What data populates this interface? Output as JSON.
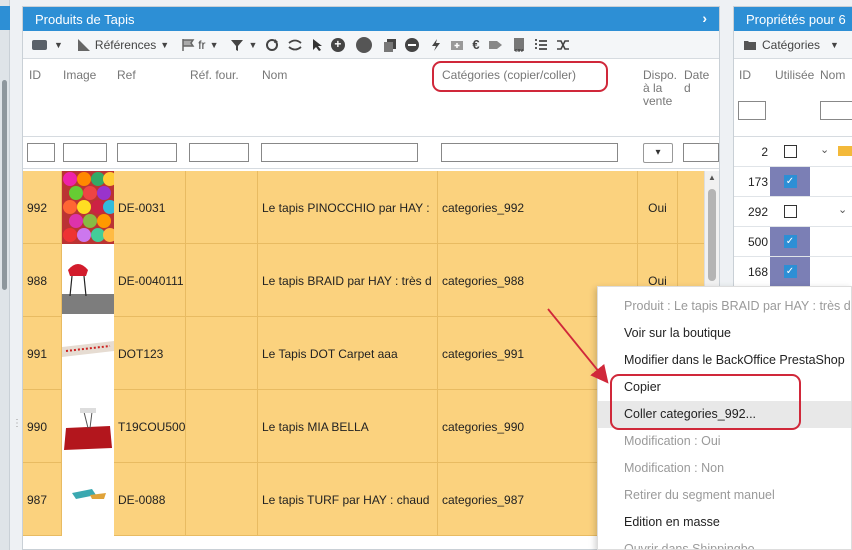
{
  "panel": {
    "title": "Produits de Tapis"
  },
  "right_panel": {
    "title": "Propriétés pour 6",
    "toolbar_label": "Catégories"
  },
  "toolbar": {
    "references_label": "Références",
    "lang_label": "fr"
  },
  "columns": {
    "id": "ID",
    "image": "Image",
    "ref": "Ref",
    "ref_four": "Réf. four.",
    "nom": "Nom",
    "categories": "Catégories (copier/coller)",
    "dispo_1": "Dispo.",
    "dispo_2": "à la",
    "dispo_3": "vente",
    "date": "Date d"
  },
  "rows": [
    {
      "id": "992",
      "ref": "DE-0031",
      "nom": "Le tapis PINOCCHIO par HAY :",
      "categories": "categories_992",
      "dispo": "Oui"
    },
    {
      "id": "988",
      "ref": "DE-0040111",
      "nom": "Le tapis BRAID par HAY : très d",
      "categories": "categories_988",
      "dispo": "Oui"
    },
    {
      "id": "991",
      "ref": "DOT123",
      "nom": "Le Tapis DOT Carpet aaa",
      "categories": "categories_991",
      "dispo": ""
    },
    {
      "id": "990",
      "ref": "T19COU500",
      "nom": "Le tapis MIA BELLA",
      "categories": "categories_990",
      "dispo": ""
    },
    {
      "id": "987",
      "ref": "DE-0088",
      "nom": "Le tapis TURF par HAY : chaud",
      "categories": "categories_987",
      "dispo": ""
    }
  ],
  "right_columns": {
    "id": "ID",
    "utilisee": "Utilisée",
    "nom": "Nom"
  },
  "right_rows": [
    {
      "id": "2",
      "checked": false
    },
    {
      "id": "173",
      "checked": true
    },
    {
      "id": "292",
      "checked": false
    },
    {
      "id": "500",
      "checked": true
    },
    {
      "id": "168",
      "checked": true
    }
  ],
  "context_menu": {
    "items": [
      {
        "label": "Produit : Le tapis BRAID par HAY : très d",
        "disabled": true
      },
      {
        "label": "Voir sur la boutique",
        "disabled": false
      },
      {
        "label": "Modifier dans le BackOffice PrestaShop",
        "disabled": false
      },
      {
        "label": "Copier",
        "disabled": false
      },
      {
        "label": "Coller categories_992...",
        "disabled": false
      },
      {
        "label": "Modification : Oui",
        "disabled": true
      },
      {
        "label": "Modification : Non",
        "disabled": true
      },
      {
        "label": "Retirer du segment manuel",
        "disabled": true
      },
      {
        "label": "Edition en masse",
        "disabled": false
      },
      {
        "label": "Ouvrir dans Shippingbo",
        "disabled": true
      }
    ]
  },
  "colors": {
    "header_blue": "#2d8fd5",
    "row_highlight": "#fbd27e",
    "annotation_red": "#d0283a"
  }
}
